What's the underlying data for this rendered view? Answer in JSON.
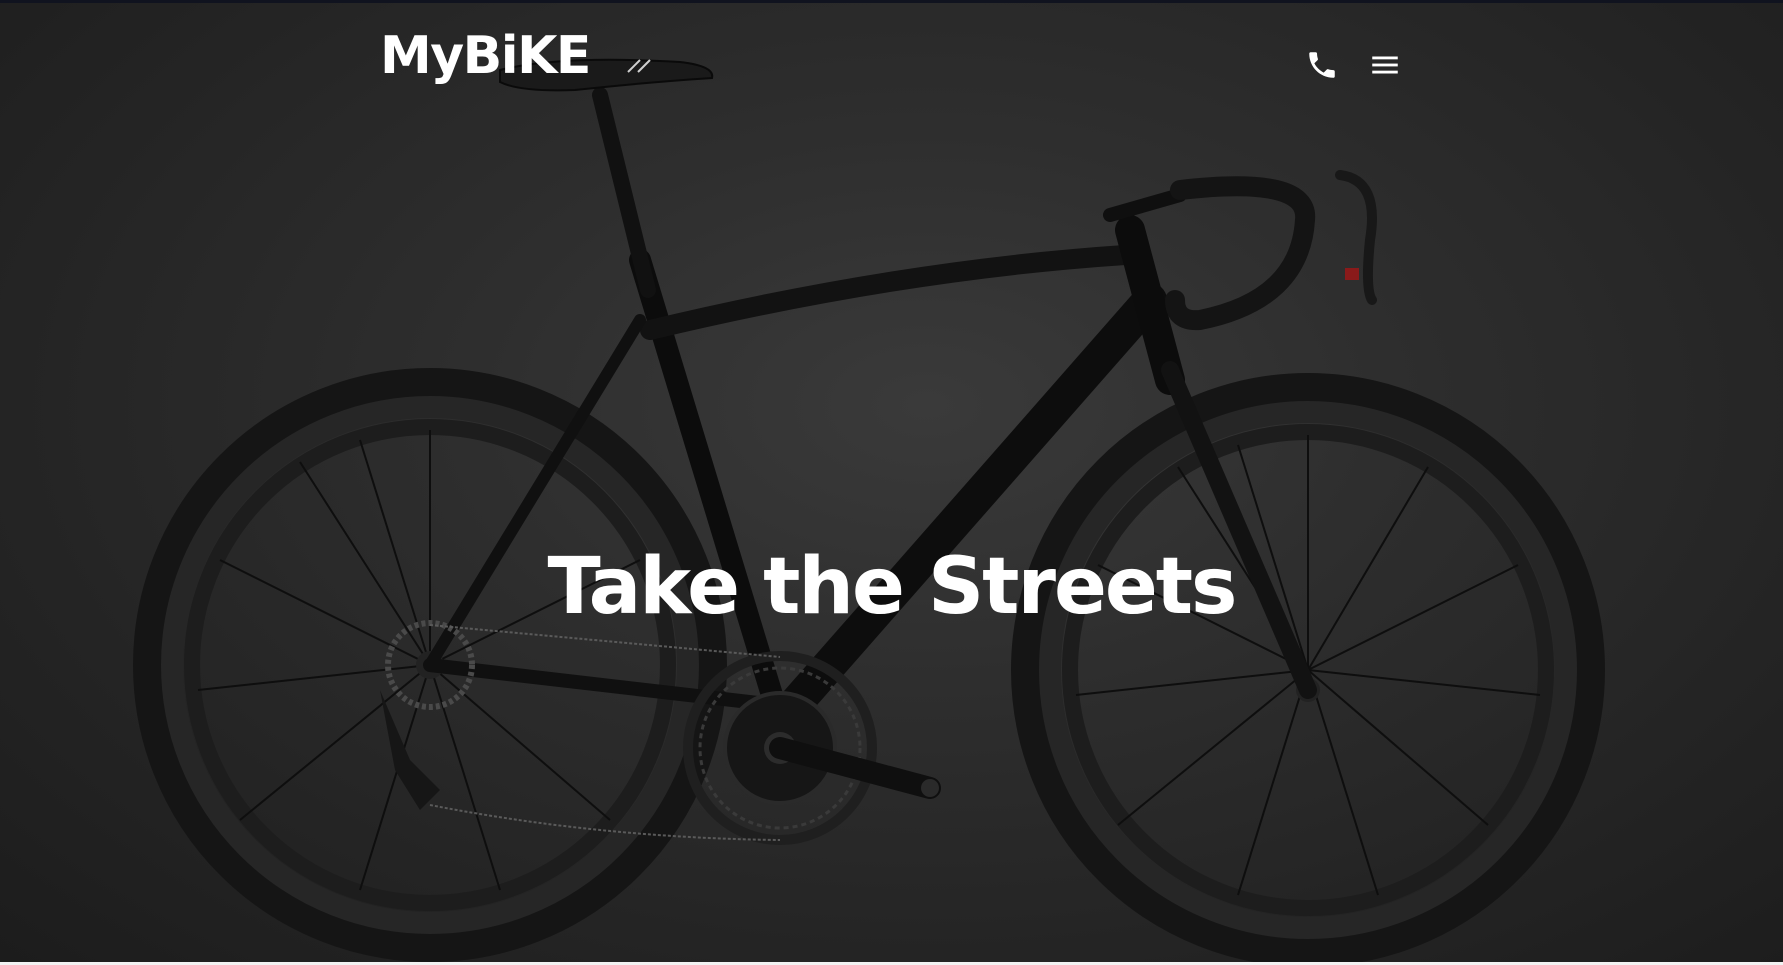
{
  "brand": {
    "logo_text": "MyBiKE"
  },
  "header": {
    "icons": [
      "phone-icon",
      "menu-icon"
    ]
  },
  "hero": {
    "headline": "Take the Streets",
    "image": "road-bicycle-photo"
  },
  "colors": {
    "background": "#2b2b2b",
    "text": "#ffffff",
    "top_strip": "#10131f"
  }
}
